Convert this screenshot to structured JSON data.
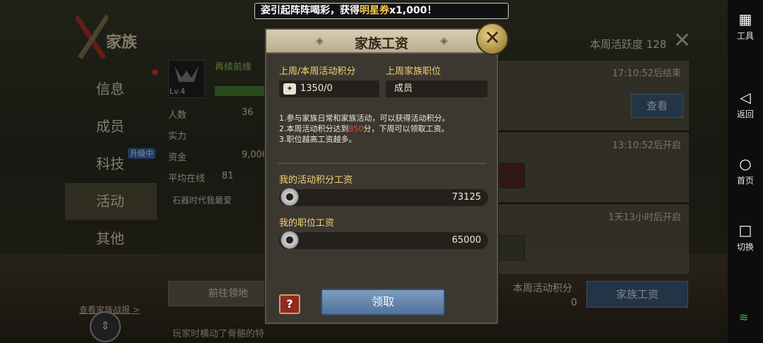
{
  "ticker": {
    "prefix": "姿引起阵阵喝彩，获得",
    "highlight": "明星券",
    "suffix": "x1,000！"
  },
  "background": {
    "clan_title": "家族",
    "weekly_activity": "本周活跃度 128",
    "nav": [
      {
        "label": "信息"
      },
      {
        "label": "成员"
      },
      {
        "label": "科技",
        "badge": "升级中"
      },
      {
        "label": "活动"
      },
      {
        "label": "其他"
      }
    ],
    "clan": {
      "level": "Lv.4",
      "name": "再续前缘",
      "exp": "97",
      "stats": [
        {
          "label": "人数",
          "value": "36"
        },
        {
          "label": "实力",
          "value": ""
        },
        {
          "label": "资金",
          "value": "9,000"
        },
        {
          "label": "平均在线",
          "value": "81"
        }
      ],
      "notice": "石器时代我最爱",
      "goto_button": "前往领地"
    },
    "events": [
      {
        "time": "17:10:52后结束",
        "button": "查看"
      },
      {
        "time": "13:10:52后开启",
        "button": ""
      },
      {
        "time": "1天13小时后开启",
        "button": ""
      }
    ],
    "weekly_points_label": "本周活动积分",
    "weekly_points_value": "0",
    "clan_salary_button": "家族工资",
    "view_report": "查看家族战报 >",
    "footer_news": "玩家时横动了骨骼的特"
  },
  "modal": {
    "title": "家族工资",
    "points_label": "上周/本周活动积分",
    "points_value": "1350/0",
    "position_label": "上周家族职位",
    "position_value": "成员",
    "rules": {
      "line1": "1.参与家族日常和家族活动，可以获得活动积分。",
      "line2_prefix": "2.本周活动积分达到",
      "line2_red": "850",
      "line2_suffix": "分，下周可以领取工资。",
      "line3": "3.职位越高工资越多。"
    },
    "activity_salary_label": "我的活动积分工资",
    "activity_salary_value": "73125",
    "position_salary_label": "我的职位工资",
    "position_salary_value": "65000",
    "help_label": "?",
    "claim_button": "领取",
    "close_label": "✕"
  },
  "sysbar": {
    "tools": "工具",
    "back": "返回",
    "home": "首页",
    "switch": "切换"
  },
  "colors": {
    "accent_gold": "#f4d27a",
    "button_blue": "#50719a",
    "rule_red": "#e04b3a"
  }
}
